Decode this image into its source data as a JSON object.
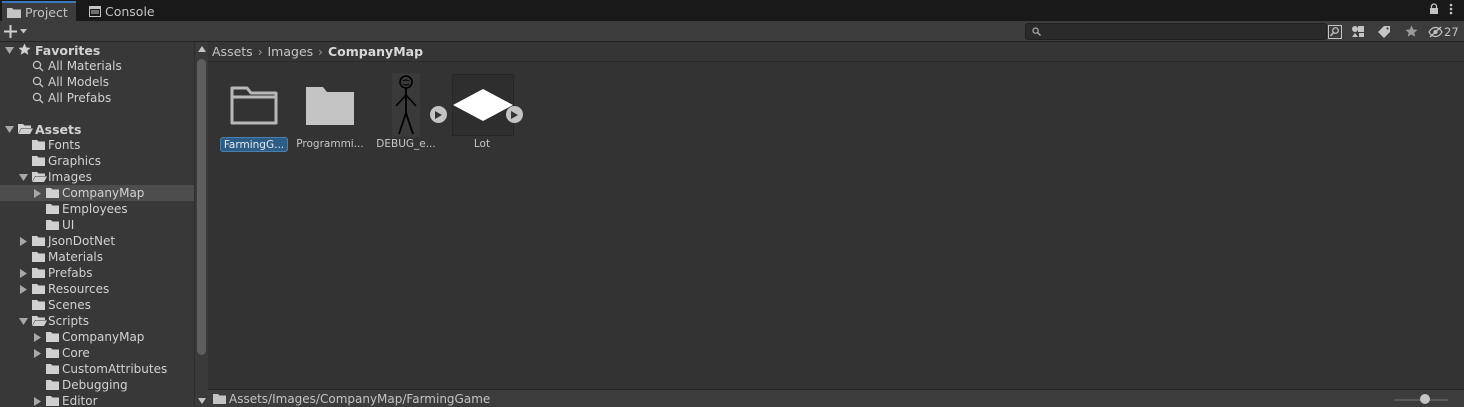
{
  "tabs": [
    {
      "label": "Project",
      "icon": "folder-icon",
      "active": true
    },
    {
      "label": "Console",
      "icon": "console-icon",
      "active": false
    }
  ],
  "toolbar": {
    "search_placeholder": "",
    "hidden_count": "27"
  },
  "tree": {
    "favorites": {
      "label": "Favorites",
      "items": [
        "All Materials",
        "All Models",
        "All Prefabs"
      ]
    },
    "assets": {
      "label": "Assets",
      "items": [
        {
          "label": "Fonts",
          "depth": 1,
          "arrow": "none",
          "open": false,
          "selected": false
        },
        {
          "label": "Graphics",
          "depth": 1,
          "arrow": "none",
          "open": false,
          "selected": false
        },
        {
          "label": "Images",
          "depth": 1,
          "arrow": "expanded",
          "open": true,
          "selected": false
        },
        {
          "label": "CompanyMap",
          "depth": 2,
          "arrow": "collapsed",
          "open": false,
          "selected": true
        },
        {
          "label": "Employees",
          "depth": 2,
          "arrow": "none",
          "open": false,
          "selected": false
        },
        {
          "label": "UI",
          "depth": 2,
          "arrow": "none",
          "open": false,
          "selected": false
        },
        {
          "label": "JsonDotNet",
          "depth": 1,
          "arrow": "collapsed",
          "open": false,
          "selected": false
        },
        {
          "label": "Materials",
          "depth": 1,
          "arrow": "none",
          "open": false,
          "selected": false
        },
        {
          "label": "Prefabs",
          "depth": 1,
          "arrow": "collapsed",
          "open": false,
          "selected": false
        },
        {
          "label": "Resources",
          "depth": 1,
          "arrow": "collapsed",
          "open": false,
          "selected": false
        },
        {
          "label": "Scenes",
          "depth": 1,
          "arrow": "none",
          "open": false,
          "selected": false
        },
        {
          "label": "Scripts",
          "depth": 1,
          "arrow": "expanded",
          "open": true,
          "selected": false
        },
        {
          "label": "CompanyMap",
          "depth": 2,
          "arrow": "collapsed",
          "open": false,
          "selected": false
        },
        {
          "label": "Core",
          "depth": 2,
          "arrow": "collapsed",
          "open": false,
          "selected": false
        },
        {
          "label": "CustomAttributes",
          "depth": 2,
          "arrow": "none",
          "open": false,
          "selected": false
        },
        {
          "label": "Debugging",
          "depth": 2,
          "arrow": "none",
          "open": false,
          "selected": false
        },
        {
          "label": "Editor",
          "depth": 2,
          "arrow": "collapsed",
          "open": false,
          "selected": false
        }
      ]
    }
  },
  "breadcrumb": [
    "Assets",
    "Images",
    "CompanyMap"
  ],
  "assets_grid": [
    {
      "label": "FarmingG...",
      "kind": "folder-empty",
      "selected": true
    },
    {
      "label": "Programmi...",
      "kind": "folder-filled",
      "selected": false
    },
    {
      "label": "DEBUG_e...",
      "kind": "sprite-stickman",
      "selected": false
    },
    {
      "label": "Lot",
      "kind": "sprite-diamond",
      "selected": false
    }
  ],
  "statusbar": {
    "path": "Assets/Images/CompanyMap/FarmingGame"
  },
  "colors": {
    "selection": "#2c5d87",
    "tab_accent": "#3a79bb",
    "panel": "#333333",
    "tree": "#383838"
  }
}
